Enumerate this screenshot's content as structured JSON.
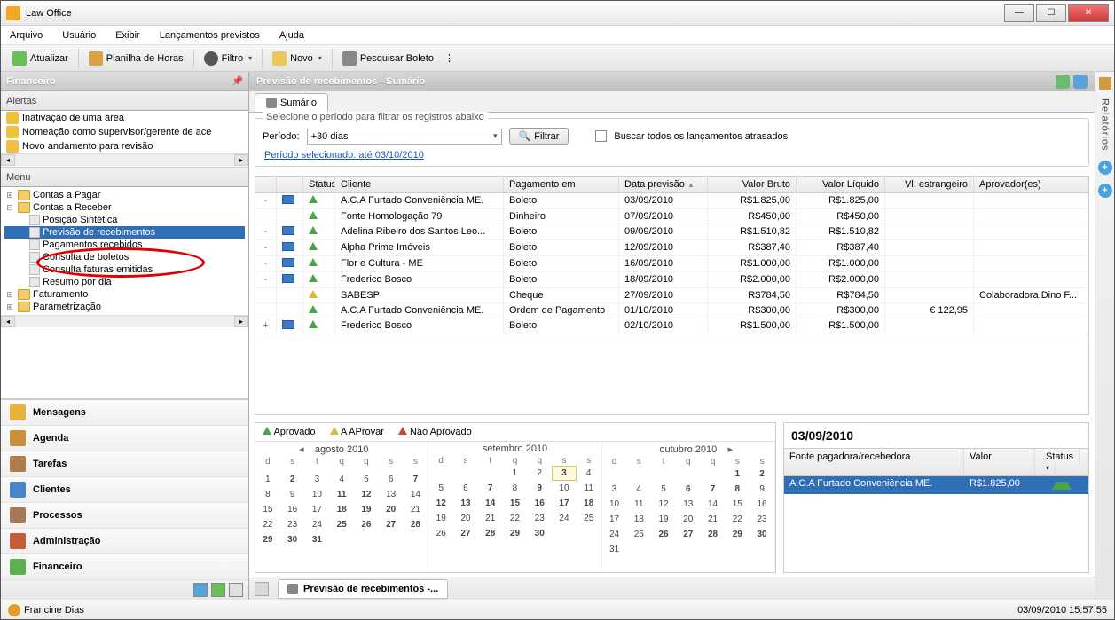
{
  "window": {
    "title": "Law Office"
  },
  "menu": {
    "items": [
      "Arquivo",
      "Usuário",
      "Exibir",
      "Lançamentos previstos",
      "Ajuda"
    ]
  },
  "toolbar": {
    "refresh": "Atualizar",
    "timesheet": "Planilha de Horas",
    "filter": "Filtro",
    "new": "Novo",
    "search": "Pesquisar Boleto"
  },
  "left": {
    "title": "Financeiro",
    "alerts_title": "Alertas",
    "alerts": [
      "Inativação de uma área",
      "Nomeação como supervisor/gerente de ace",
      "Novo andamento para revisão"
    ],
    "menu_title": "Menu",
    "tree": {
      "pagar": "Contas a Pagar",
      "receber": "Contas a Receber",
      "r_items": [
        "Posição Sintética",
        "Previsão de recebimentos",
        "Pagamentos recebidos",
        "Consulta de boletos",
        "Consulta faturas emitidas",
        "Resumo por dia"
      ],
      "fatur": "Faturamento",
      "param": "Parametrização"
    },
    "nav": [
      "Mensagens",
      "Agenda",
      "Tarefas",
      "Clientes",
      "Processos",
      "Administração",
      "Financeiro"
    ]
  },
  "main": {
    "title": "Previsão de recebimentos - Sumário",
    "tab": "Sumário",
    "filter": {
      "legend": "Selecione o período para filtrar os registros abaixo",
      "periodo_lbl": "Período:",
      "periodo_val": "+30 dias",
      "filtrar": "Filtrar",
      "buscar": "Buscar todos os lançamentos atrasados",
      "period_sel": "Período selecionado:  até 03/10/2010"
    },
    "cols": {
      "status": "Status",
      "cliente": "Cliente",
      "pag": "Pagamento em",
      "data": "Data previsão",
      "vb": "Valor Bruto",
      "vl": "Valor Líquido",
      "ve": "Vl. estrangeiro",
      "apr": "Aprovador(es)"
    },
    "rows": [
      {
        "exp": "-",
        "pic": true,
        "fy": false,
        "cli": "A.C.A Furtado Conveniência ME.",
        "pag": "Boleto",
        "data": "03/09/2010",
        "vb": "R$1.825,00",
        "vl": "R$1.825,00",
        "ve": "",
        "apr": ""
      },
      {
        "exp": "",
        "pic": false,
        "fy": false,
        "cli": "Fonte Homologação 79",
        "pag": "Dinheiro",
        "data": "07/09/2010",
        "vb": "R$450,00",
        "vl": "R$450,00",
        "ve": "",
        "apr": ""
      },
      {
        "exp": "-",
        "pic": true,
        "fy": false,
        "cli": "Adelina Ribeiro dos Santos Leo...",
        "pag": "Boleto",
        "data": "09/09/2010",
        "vb": "R$1.510,82",
        "vl": "R$1.510,82",
        "ve": "",
        "apr": ""
      },
      {
        "exp": "-",
        "pic": true,
        "fy": false,
        "cli": "Alpha Prime Imóveis",
        "pag": "Boleto",
        "data": "12/09/2010",
        "vb": "R$387,40",
        "vl": "R$387,40",
        "ve": "",
        "apr": ""
      },
      {
        "exp": "-",
        "pic": true,
        "fy": false,
        "cli": "Flor e Cultura - ME",
        "pag": "Boleto",
        "data": "16/09/2010",
        "vb": "R$1.000,00",
        "vl": "R$1.000,00",
        "ve": "",
        "apr": ""
      },
      {
        "exp": "-",
        "pic": true,
        "fy": false,
        "cli": "Frederico Bosco",
        "pag": "Boleto",
        "data": "18/09/2010",
        "vb": "R$2.000,00",
        "vl": "R$2.000,00",
        "ve": "",
        "apr": ""
      },
      {
        "exp": "",
        "pic": false,
        "fy": true,
        "cli": "SABESP",
        "pag": "Cheque",
        "data": "27/09/2010",
        "vb": "R$784,50",
        "vl": "R$784,50",
        "ve": "",
        "apr": "Colaboradora,Dino  F..."
      },
      {
        "exp": "",
        "pic": false,
        "fy": false,
        "cli": "A.C.A Furtado Conveniência ME.",
        "pag": "Ordem de Pagamento",
        "data": "01/10/2010",
        "vb": "R$300,00",
        "vl": "R$300,00",
        "ve": "€ 122,95",
        "apr": ""
      },
      {
        "exp": "+",
        "pic": true,
        "fy": false,
        "cli": "Frederico Bosco",
        "pag": "Boleto",
        "data": "02/10/2010",
        "vb": "R$1.500,00",
        "vl": "R$1.500,00",
        "ve": "",
        "apr": ""
      }
    ],
    "legend": {
      "apr": "Aprovado",
      "aap": "A AProvar",
      "nap": "Não Aprovado"
    },
    "cals": [
      {
        "title": "agosto 2010",
        "prev": true,
        "days": [
          [
            "",
            "",
            "",
            "",
            "",
            "",
            ""
          ],
          [
            "1",
            "2",
            "3",
            "4",
            "5",
            "6",
            "7"
          ],
          [
            "8",
            "9",
            "10",
            "11",
            "12",
            "13",
            "14"
          ],
          [
            "15",
            "16",
            "17",
            "18",
            "19",
            "20",
            "21"
          ],
          [
            "22",
            "23",
            "24",
            "25",
            "26",
            "27",
            "28"
          ],
          [
            "29",
            "30",
            "31",
            "",
            "",
            "",
            ""
          ]
        ],
        "bold": [
          "2",
          "7",
          "11",
          "12",
          "18",
          "19",
          "20",
          "25",
          "26",
          "27",
          "28",
          "29",
          "30",
          "31"
        ]
      },
      {
        "title": "setembro 2010",
        "days": [
          [
            "",
            "",
            "",
            "1",
            "2",
            "3",
            "4"
          ],
          [
            "5",
            "6",
            "7",
            "8",
            "9",
            "10",
            "11"
          ],
          [
            "12",
            "13",
            "14",
            "15",
            "16",
            "17",
            "18"
          ],
          [
            "19",
            "20",
            "21",
            "22",
            "23",
            "24",
            "25"
          ],
          [
            "26",
            "27",
            "28",
            "29",
            "30",
            "",
            ""
          ]
        ],
        "bold": [
          "3",
          "7",
          "9",
          "12",
          "13",
          "14",
          "15",
          "16",
          "17",
          "18",
          "27",
          "28",
          "29",
          "30"
        ],
        "today": "3"
      },
      {
        "title": "outubro 2010",
        "next": true,
        "days": [
          [
            "",
            "",
            "",
            "",
            "",
            "1",
            "2"
          ],
          [
            "3",
            "4",
            "5",
            "6",
            "7",
            "8",
            "9"
          ],
          [
            "10",
            "11",
            "12",
            "13",
            "14",
            "15",
            "16"
          ],
          [
            "17",
            "18",
            "19",
            "20",
            "21",
            "22",
            "23"
          ],
          [
            "24",
            "25",
            "26",
            "27",
            "28",
            "29",
            "30"
          ],
          [
            "31",
            "",
            "",
            "",
            "",
            "",
            ""
          ]
        ],
        "bold": [
          "1",
          "2",
          "6",
          "7",
          "8",
          "26",
          "27",
          "28",
          "29",
          "30"
        ]
      }
    ],
    "dow": [
      "d",
      "s",
      "t",
      "q",
      "q",
      "s",
      "s"
    ],
    "detail": {
      "date": "03/09/2010",
      "cols": {
        "fonte": "Fonte pagadora/recebedora",
        "valor": "Valor",
        "status": "Status"
      },
      "row": {
        "fonte": "A.C.A Furtado Conveniência ME.",
        "valor": "R$1.825,00"
      }
    },
    "btab": "Previsão de recebimentos -..."
  },
  "rside": {
    "label": "Relatórios"
  },
  "status": {
    "user": "Francine Dias",
    "time": "03/09/2010 15:57:55"
  }
}
